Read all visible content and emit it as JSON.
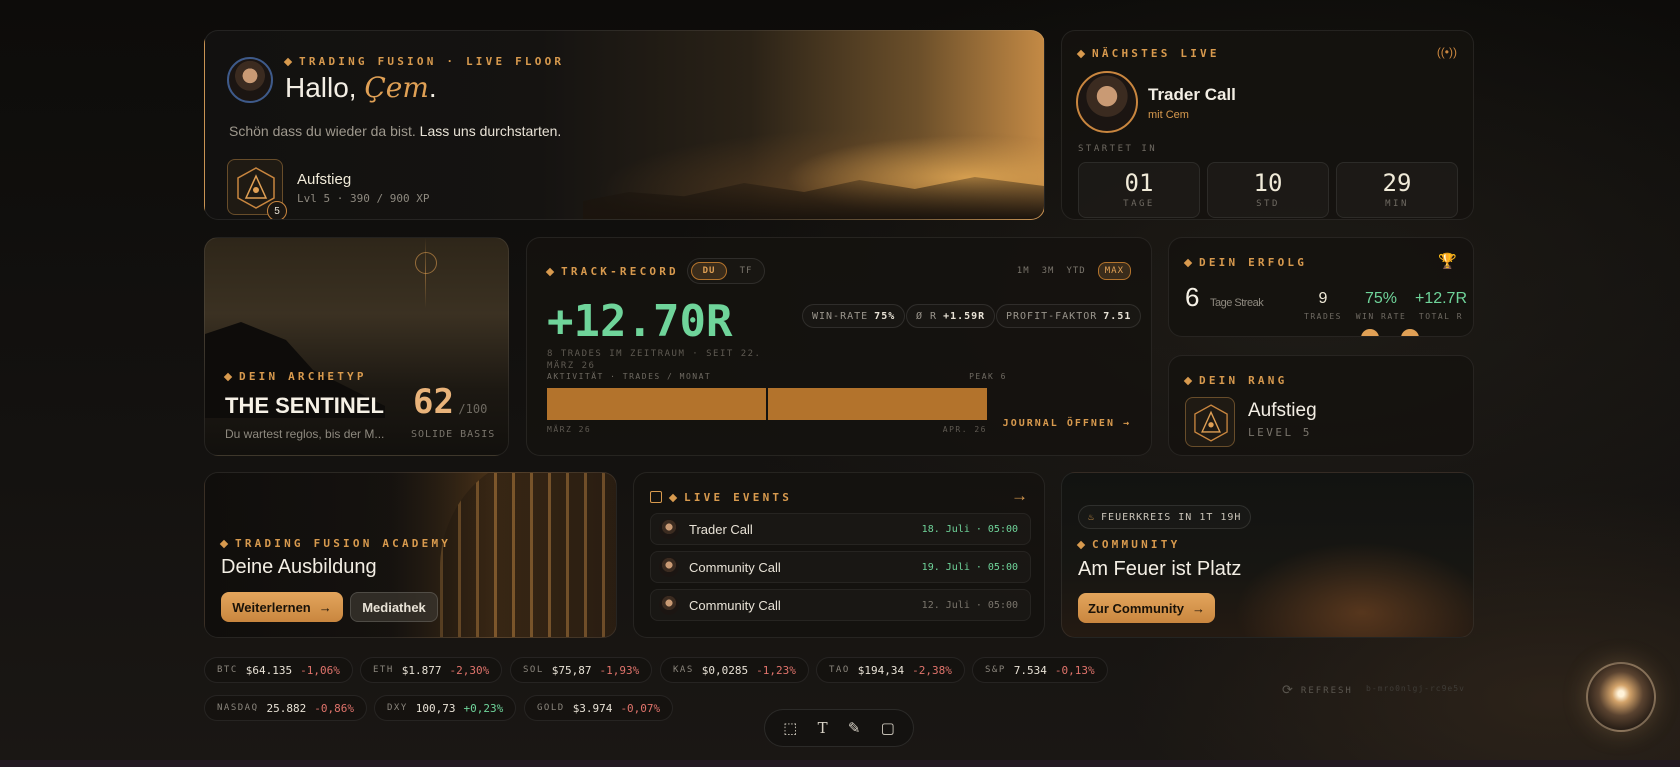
{
  "hero": {
    "eyebrow": "TRADING FUSION · LIVE FLOOR",
    "greeting": "Hallo,",
    "name": "Çem",
    "name_suffix": ".",
    "subtitle_a": "Schön dass du wieder da bist.",
    "subtitle_b": "Lass uns durchstarten.",
    "badge_level_num": "5",
    "rank_title": "Aufstieg",
    "rank_meta": "Lvl 5 · 390 / 900 XP"
  },
  "next_live": {
    "eyebrow": "NÄCHSTES LIVE",
    "title": "Trader Call",
    "host": "mit Cem",
    "starts_label": "STARTET IN",
    "countdown": [
      {
        "value": "01",
        "label": "TAGE"
      },
      {
        "value": "10",
        "label": "STD"
      },
      {
        "value": "29",
        "label": "MIN"
      }
    ]
  },
  "archetype": {
    "eyebrow": "DEIN ARCHETYP",
    "name": "THE SENTINEL",
    "desc": "Du wartest reglos, bis der M...",
    "score": "62",
    "score_max": "/100",
    "score_label": "SOLIDE BASIS"
  },
  "track": {
    "eyebrow": "TRACK-RECORD",
    "toggle": [
      "DU",
      "TF"
    ],
    "ranges": [
      "1M",
      "3M",
      "YTD",
      "MAX"
    ],
    "value": "+12.70R",
    "subline": "8 TRADES IM ZEITRAUM · SEIT 22. MÄRZ 26",
    "stats": [
      {
        "label": "WIN-RATE",
        "value": "75%"
      },
      {
        "label": "Ø R",
        "value": "+1.59R"
      },
      {
        "label": "PROFIT-FAKTOR",
        "value": "7.51"
      }
    ],
    "activity_label": "AKTIVITÄT · TRADES / MONAT",
    "peak_label": "PEAK 6",
    "axis_start": "MÄRZ 26",
    "axis_end": "APR. 26",
    "journal_link": "JOURNAL ÖFFNEN →",
    "bar_color": "#b3732c"
  },
  "erfolg": {
    "eyebrow": "DEIN ERFOLG",
    "streak_num": "6",
    "streak_label": "Tage Streak",
    "stats": [
      {
        "value": "9",
        "label": "TRADES"
      },
      {
        "value": "75%",
        "label": "WIN RATE"
      },
      {
        "value": "+12.7R",
        "label": "TOTAL R"
      }
    ]
  },
  "rang": {
    "eyebrow": "DEIN RANG",
    "title": "Aufstieg",
    "level": "LEVEL 5"
  },
  "academy": {
    "eyebrow": "TRADING FUSION ACADEMY",
    "title": "Deine Ausbildung",
    "primary": "Weiterlernen",
    "secondary": "Mediathek"
  },
  "events": {
    "eyebrow": "LIVE EVENTS",
    "items": [
      {
        "title": "Trader Call",
        "date": "18. Juli · 05:00"
      },
      {
        "title": "Community Call",
        "date": "19. Juli · 05:00"
      },
      {
        "title": "Community Call",
        "date": "12. Juli · 05:00"
      }
    ]
  },
  "community": {
    "chip": "FEUERKREIS IN 1T 19H",
    "eyebrow": "COMMUNITY",
    "title": "Am Feuer ist Platz",
    "button": "Zur Community"
  },
  "tickers_row1": [
    {
      "sym": "BTC",
      "price": "$64.135",
      "chg": "-1,06%"
    },
    {
      "sym": "ETH",
      "price": "$1.877",
      "chg": "-2,30%"
    },
    {
      "sym": "SOL",
      "price": "$75,87",
      "chg": "-1,93%"
    },
    {
      "sym": "KAS",
      "price": "$0,0285",
      "chg": "-1,23%"
    },
    {
      "sym": "TAO",
      "price": "$194,34",
      "chg": "-2,38%"
    },
    {
      "sym": "S&P",
      "price": "7.534",
      "chg": "-0,13%"
    }
  ],
  "tickers_row2": [
    {
      "sym": "NASDAQ",
      "price": "25.882",
      "chg": "-0,86%"
    },
    {
      "sym": "DXY",
      "price": "100,73",
      "chg": "+0,23%"
    },
    {
      "sym": "GOLD",
      "price": "$3.974",
      "chg": "-0,07%"
    }
  ],
  "footer": {
    "refresh": "REFRESH",
    "build": "b-mro0nlgj-rc9e5v"
  },
  "colors": {
    "accent": "#d89a4e",
    "positive": "#6fd49a",
    "negative": "#e0736b"
  }
}
